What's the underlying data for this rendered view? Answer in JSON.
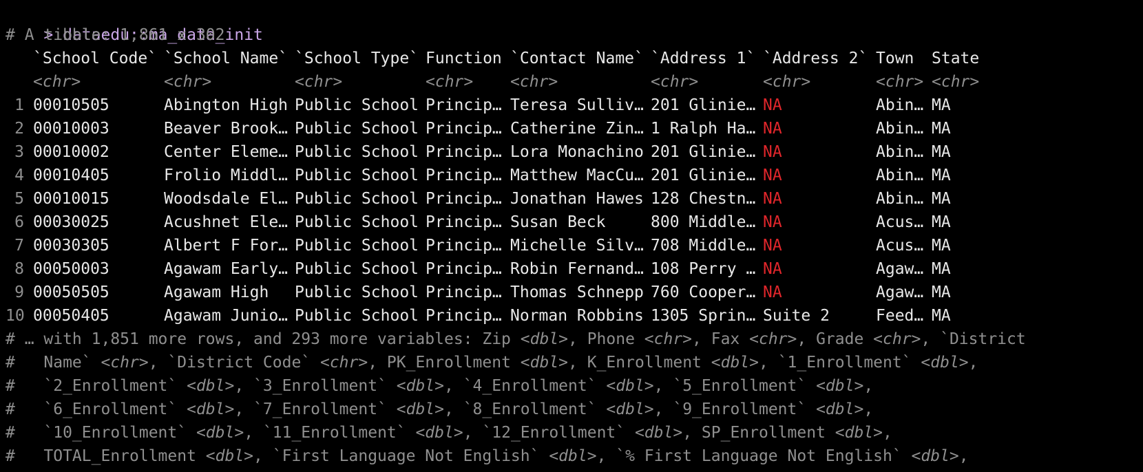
{
  "console": {
    "prompt": ">",
    "command": "dataedu::ma_data_init",
    "tibble_info": "# A tibble: 1,861 x 302",
    "colors": {
      "background": "#000000",
      "text": "#e8e8e8",
      "prompt": "#c9a6e6",
      "muted": "#8f8f8f",
      "na": "#e0262b"
    }
  },
  "table": {
    "headers": [
      "`School Code`",
      "`School Name`",
      "`School Type`",
      "Function",
      "`Contact Name`",
      "`Address 1`",
      "`Address 2`",
      "Town",
      "State"
    ],
    "types": [
      "<chr>",
      "<chr>",
      "<chr>",
      "<chr>",
      "<chr>",
      "<chr>",
      "<chr>",
      "<chr>",
      "<chr>"
    ],
    "rows": [
      [
        "1",
        "00010505",
        "Abington High",
        "Public School",
        "Princip…",
        "Teresa Sulliv…",
        "201 Glinie…",
        "NA",
        "Abin…",
        "MA"
      ],
      [
        "2",
        "00010003",
        "Beaver Brook…",
        "Public School",
        "Princip…",
        "Catherine Zin…",
        "1 Ralph Ha…",
        "NA",
        "Abin…",
        "MA"
      ],
      [
        "3",
        "00010002",
        "Center Eleme…",
        "Public School",
        "Princip…",
        "Lora Monachino",
        "201 Glinie…",
        "NA",
        "Abin…",
        "MA"
      ],
      [
        "4",
        "00010405",
        "Frolio Middl…",
        "Public School",
        "Princip…",
        "Matthew MacCu…",
        "201 Glinie…",
        "NA",
        "Abin…",
        "MA"
      ],
      [
        "5",
        "00010015",
        "Woodsdale El…",
        "Public School",
        "Princip…",
        "Jonathan Hawes",
        "128 Chestn…",
        "NA",
        "Abin…",
        "MA"
      ],
      [
        "6",
        "00030025",
        "Acushnet Ele…",
        "Public School",
        "Princip…",
        "Susan Beck",
        "800 Middle…",
        "NA",
        "Acus…",
        "MA"
      ],
      [
        "7",
        "00030305",
        "Albert F For…",
        "Public School",
        "Princip…",
        "Michelle Silv…",
        "708 Middle…",
        "NA",
        "Acus…",
        "MA"
      ],
      [
        "8",
        "00050003",
        "Agawam Early…",
        "Public School",
        "Princip…",
        "Robin Fernand…",
        "108 Perry …",
        "NA",
        "Agaw…",
        "MA"
      ],
      [
        "9",
        "00050505",
        "Agawam High",
        "Public School",
        "Princip…",
        "Thomas Schnepp",
        "760 Cooper…",
        "NA",
        "Agaw…",
        "MA"
      ],
      [
        "10",
        "00050405",
        "Agawam Junio…",
        "Public School",
        "Princip…",
        "Norman Robbins",
        "1305 Sprin…",
        "Suite 2",
        "Feed…",
        "MA"
      ]
    ]
  },
  "footer": [
    [
      {
        "t": "# … with 1,851 more rows, and 293 more variables: Zip ",
        "c": "gray"
      },
      {
        "t": "<dbl>",
        "c": "type"
      },
      {
        "t": ", Phone ",
        "c": "gray"
      },
      {
        "t": "<chr>",
        "c": "type"
      },
      {
        "t": ", Fax ",
        "c": "gray"
      },
      {
        "t": "<chr>",
        "c": "type"
      },
      {
        "t": ", Grade ",
        "c": "gray"
      },
      {
        "t": "<chr>",
        "c": "type"
      },
      {
        "t": ", `District",
        "c": "gray"
      }
    ],
    [
      {
        "t": "#   Name` ",
        "c": "gray"
      },
      {
        "t": "<chr>",
        "c": "type"
      },
      {
        "t": ", `District Code` ",
        "c": "gray"
      },
      {
        "t": "<chr>",
        "c": "type"
      },
      {
        "t": ", PK_Enrollment ",
        "c": "gray"
      },
      {
        "t": "<dbl>",
        "c": "type"
      },
      {
        "t": ", K_Enrollment ",
        "c": "gray"
      },
      {
        "t": "<dbl>",
        "c": "type"
      },
      {
        "t": ", `1_Enrollment` ",
        "c": "gray"
      },
      {
        "t": "<dbl>",
        "c": "type"
      },
      {
        "t": ",",
        "c": "gray"
      }
    ],
    [
      {
        "t": "#   `2_Enrollment` ",
        "c": "gray"
      },
      {
        "t": "<dbl>",
        "c": "type"
      },
      {
        "t": ", `3_Enrollment` ",
        "c": "gray"
      },
      {
        "t": "<dbl>",
        "c": "type"
      },
      {
        "t": ", `4_Enrollment` ",
        "c": "gray"
      },
      {
        "t": "<dbl>",
        "c": "type"
      },
      {
        "t": ", `5_Enrollment` ",
        "c": "gray"
      },
      {
        "t": "<dbl>",
        "c": "type"
      },
      {
        "t": ",",
        "c": "gray"
      }
    ],
    [
      {
        "t": "#   `6_Enrollment` ",
        "c": "gray"
      },
      {
        "t": "<dbl>",
        "c": "type"
      },
      {
        "t": ", `7_Enrollment` ",
        "c": "gray"
      },
      {
        "t": "<dbl>",
        "c": "type"
      },
      {
        "t": ", `8_Enrollment` ",
        "c": "gray"
      },
      {
        "t": "<dbl>",
        "c": "type"
      },
      {
        "t": ", `9_Enrollment` ",
        "c": "gray"
      },
      {
        "t": "<dbl>",
        "c": "type"
      },
      {
        "t": ",",
        "c": "gray"
      }
    ],
    [
      {
        "t": "#   `10_Enrollment` ",
        "c": "gray"
      },
      {
        "t": "<dbl>",
        "c": "type"
      },
      {
        "t": ", `11_Enrollment` ",
        "c": "gray"
      },
      {
        "t": "<dbl>",
        "c": "type"
      },
      {
        "t": ", `12_Enrollment` ",
        "c": "gray"
      },
      {
        "t": "<dbl>",
        "c": "type"
      },
      {
        "t": ", SP_Enrollment ",
        "c": "gray"
      },
      {
        "t": "<dbl>",
        "c": "type"
      },
      {
        "t": ",",
        "c": "gray"
      }
    ],
    [
      {
        "t": "#   TOTAL_Enrollment ",
        "c": "gray"
      },
      {
        "t": "<dbl>",
        "c": "type"
      },
      {
        "t": ", `First Language Not English` ",
        "c": "gray"
      },
      {
        "t": "<dbl>",
        "c": "type"
      },
      {
        "t": ", `% First Language Not English` ",
        "c": "gray"
      },
      {
        "t": "<dbl>",
        "c": "type"
      },
      {
        "t": ",",
        "c": "gray"
      }
    ]
  ]
}
